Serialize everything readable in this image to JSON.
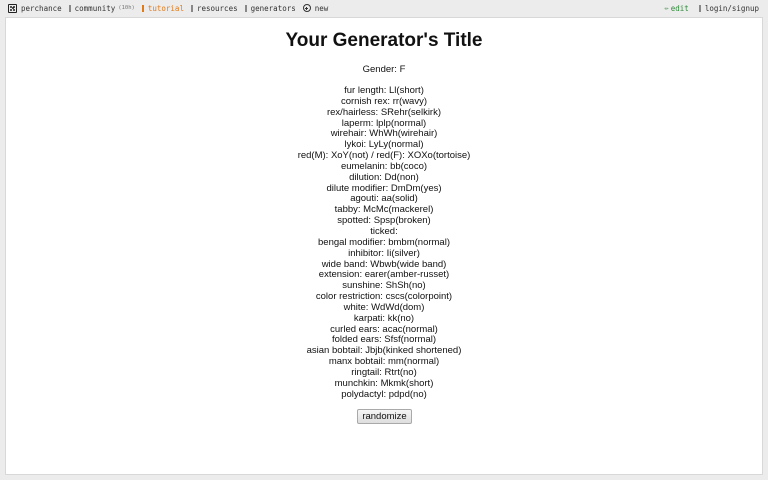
{
  "nav": {
    "site": "perchance",
    "community": "community",
    "community_count": "(10h)",
    "tutorial": "tutorial",
    "resources": "resources",
    "generators": "generators",
    "new": "new",
    "edit": "edit",
    "login": "login/signup"
  },
  "page": {
    "title": "Your Generator's Title",
    "gender": "Gender: F",
    "traits": [
      "fur length: Ll(short)",
      "cornish rex: rr(wavy)",
      "rex/hairless: SRehr(selkirk)",
      "laperm: lplp(normal)",
      "wirehair: WhWh(wirehair)",
      "lykoi: LyLy(normal)",
      "red(M): XoY(not) / red(F): XOXo(tortoise)",
      "eumelanin: bb(coco)",
      "dilution: Dd(non)",
      "dilute modifier: DmDm(yes)",
      "agouti: aa(solid)",
      "tabby: McMc(mackerel)",
      "spotted: Spsp(broken)",
      "ticked:",
      "bengal modifier: bmbm(normal)",
      "inhibitor: Ii(silver)",
      "wide band: Wbwb(wide band)",
      "extension: earer(amber-russet)",
      "sunshine: ShSh(no)",
      "color restriction: cscs(colorpoint)",
      "white: WdWd(dom)",
      "karpati: kk(no)",
      "curled ears: acac(normal)",
      "folded ears: Sfsf(normal)",
      "asian bobtail: Jbjb(kinked shortened)",
      "manx bobtail: mm(normal)",
      "ringtail: Rtrt(no)",
      "munchkin: Mkmk(short)",
      "polydactyl: pdpd(no)"
    ],
    "randomize_label": "randomize"
  },
  "colors": {
    "tutorial": "#e07b1a",
    "edit": "#2e8b3a",
    "background": "#ececec",
    "panel": "#ffffff"
  },
  "icons": [
    "dice-icon",
    "book-icon",
    "plus-icon",
    "pencil-icon"
  ]
}
